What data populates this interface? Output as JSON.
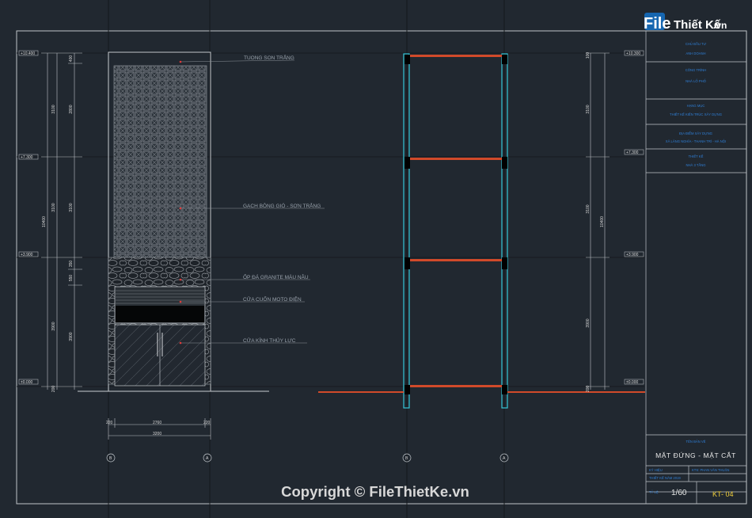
{
  "logo": {
    "part1": "File",
    "part2": "Thiết Kế",
    "part3": ".vn"
  },
  "copyright": "Copyright © FileThietKe.vn",
  "levels": {
    "left": [
      "+10.400",
      "+7.300",
      "+3.900",
      "±0.000"
    ],
    "right": [
      "+10.300",
      "+7.300",
      "+3.900",
      "±0.000"
    ]
  },
  "facade": {
    "dims_outer": [
      "3100",
      "3100",
      "10400",
      "3900"
    ],
    "dims_inner": [
      "400",
      "2800",
      "3100",
      "350",
      "550",
      "3900",
      "200"
    ],
    "bottom_dims": {
      "left": "220",
      "mid": "2760",
      "right": "220",
      "total": "3200"
    },
    "axes": [
      "B",
      "A"
    ]
  },
  "annotations": [
    "TUONG SON TRẮNG",
    "GẠCH BÔNG GIÓ - SƠN TRẮNG",
    "ỐP ĐÁ GRANITE MÀU NÂU",
    "CỬA CUỐN MOTO ĐIỆN",
    "CỬA KÍNH THỦY LỰC"
  ],
  "section": {
    "dims_floor": [
      "3100",
      "3100",
      "3900"
    ],
    "dims_small": [
      "100",
      "200"
    ],
    "dims_total": "10400",
    "axes": [
      "B",
      "A"
    ]
  },
  "title_block": {
    "owner_label": "CHỦ ĐẦU TƯ",
    "owner": "ANH DOANH",
    "project_label": "CÔNG TRÌNH",
    "project": "NHÀ LỐ PHỐ",
    "category_label": "HẠNG MỤC",
    "category": "THIẾT KẾ KIẾN TRÚC XÂY DỰNG",
    "location_label": "ĐỊA ĐIỂM XÂY DỰNG",
    "location": "XÃ LÃNG NGHĨA - THANH TRÌ - HÀ NỘI",
    "design_label": "THIẾT KẾ",
    "design": "NHÀ 3 TẦNG",
    "drawing_label": "TÊN BẢN VẼ",
    "drawing_title": "MẶT ĐỨNG - MẶT CẮT",
    "row1_a": "KÝ HIỆU",
    "row1_b": "KTS: PHAN VĂN THUẬN",
    "row2_a": "THIẾT KẾ NĂM 2019",
    "scale_label": "TỶ LỆ",
    "scale": "1/60",
    "sheet": "KT- 04"
  }
}
